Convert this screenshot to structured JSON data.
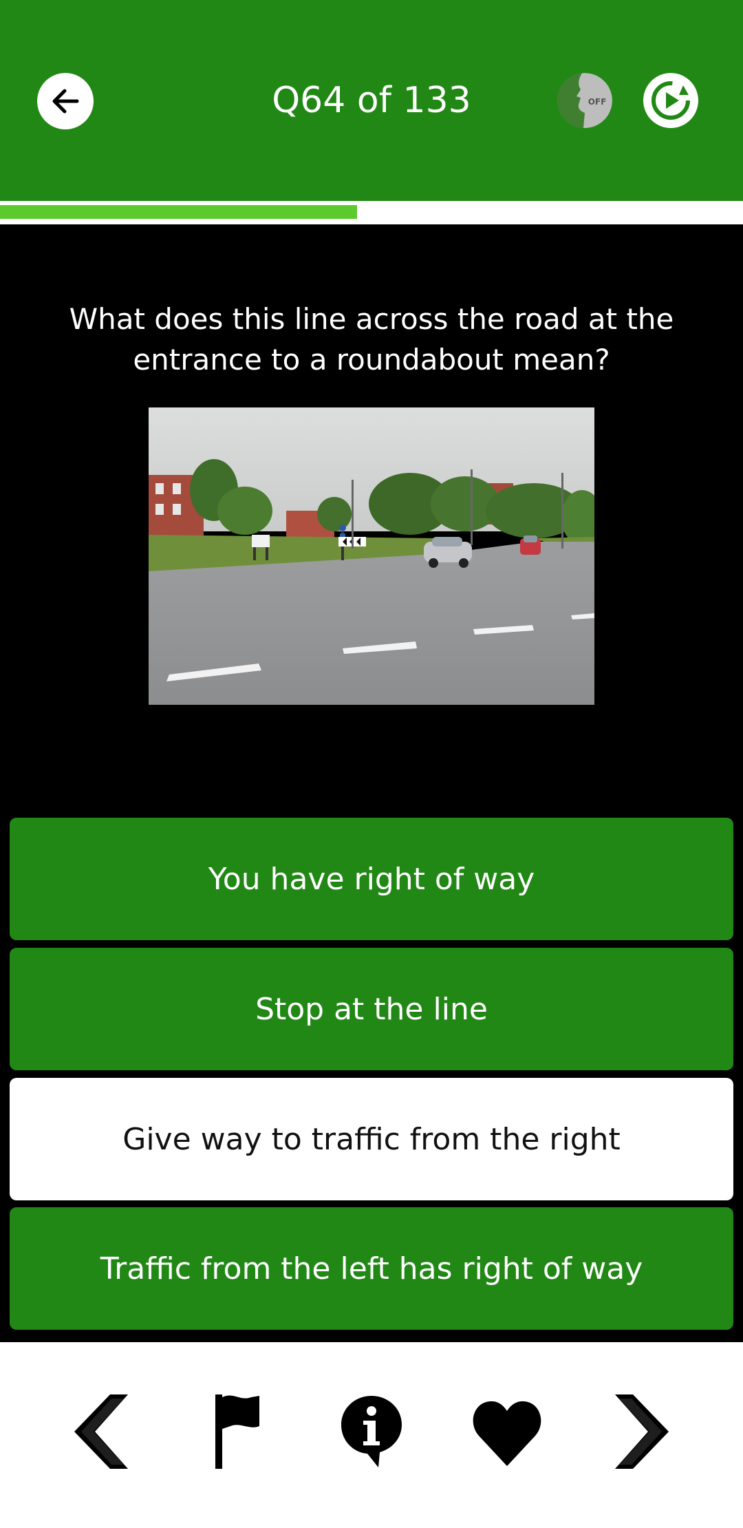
{
  "header": {
    "title": "Q64 of 133",
    "voice_state": "OFF",
    "accent": "#218815"
  },
  "progress": {
    "current": 64,
    "total": 133,
    "fraction": 0.481
  },
  "question": {
    "text": "What does this line across the road at the entrance to a roundabout mean?",
    "image": "roundabout-entrance-photo"
  },
  "answers": [
    {
      "label": "You have right of way",
      "selected": false
    },
    {
      "label": "Stop at the line",
      "selected": false
    },
    {
      "label": "Give way to traffic from the right",
      "selected": true
    },
    {
      "label": "Traffic from the left has right of way",
      "selected": false
    }
  ],
  "bottom_nav": {
    "icons": [
      "chevron-left-icon",
      "flag-icon",
      "info-icon",
      "heart-icon",
      "chevron-right-icon"
    ]
  }
}
